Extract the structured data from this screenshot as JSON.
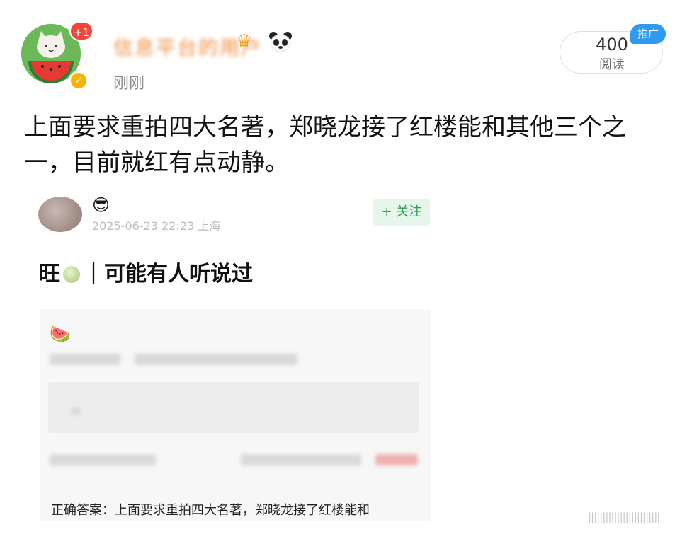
{
  "post": {
    "avatar_badge": "+1",
    "username": "信息平台的用户",
    "timestamp": "刚刚",
    "read_count": "400",
    "read_label": "阅读",
    "promo_tag": "推广",
    "text": "上面要求重拍四大名著，郑晓龙接了红楼能和其他三个之一，目前就红有点动静。"
  },
  "embed": {
    "emoji": "😎",
    "timestamp": "2025-06-23 22:23 上海",
    "follow_label": "+ 关注",
    "title_prefix": "旺",
    "title_suffix": "｜可能有人听说过",
    "card_emoji": "🍉",
    "answer": "正确答案：上面要求重拍四大名著，郑晓龙接了红楼能和"
  },
  "watermark": "|||||||||||||||||||||||||",
  "icons": {
    "crown": "crown-icon",
    "panda": "panda-icon",
    "verified": "verified-icon"
  },
  "colors": {
    "accent_blue": "#2e9bf0",
    "badge_red": "#f2463c",
    "follow_green": "#2ea44f",
    "verified_gold": "#f7b500"
  }
}
